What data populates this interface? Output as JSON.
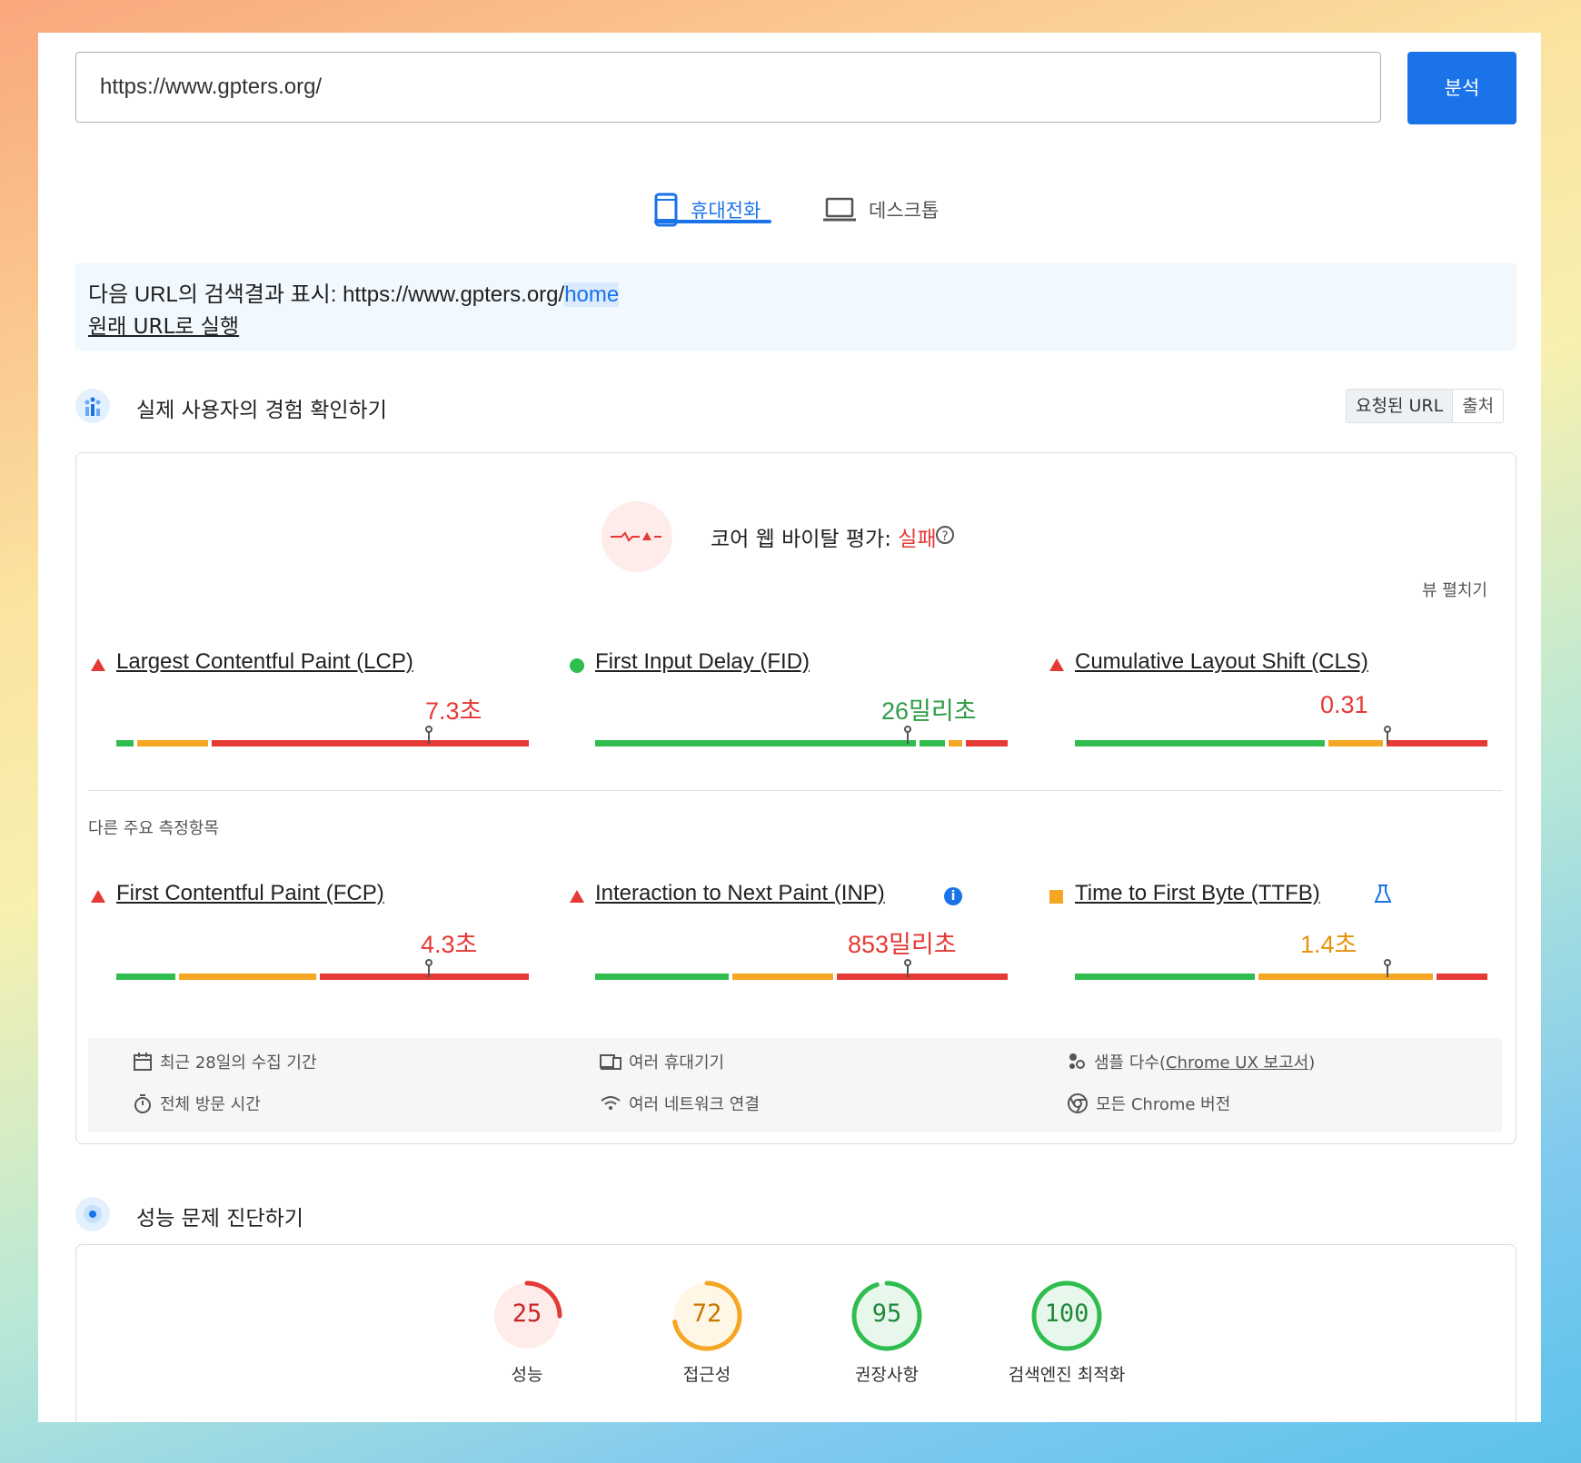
{
  "search": {
    "url": "https://www.gpters.org/",
    "analyze_label": "분석"
  },
  "tabs": [
    {
      "label": "휴대전화"
    },
    {
      "label": "데스크톱"
    }
  ],
  "redirect": {
    "prefix": "다음 URL의 검색결과 표시: https://www.gpters.org/",
    "highlight": "home",
    "link": "원래 URL로 실행"
  },
  "field": {
    "title": "실제 사용자의 경험 확인하기",
    "toggle": [
      "요청된 URL",
      "출처"
    ],
    "assessment_label": "코어 웹 바이탈 평가: ",
    "assessment_status": "실패",
    "expand_label": "뷰 펼치기",
    "core_metrics": [
      {
        "name": "Largest Contentful Paint (LCP)",
        "value": "7.3초",
        "status": "poor",
        "marker": 0.75
      },
      {
        "name": "First Input Delay (FID)",
        "value": "26밀리초",
        "status": "good",
        "marker": 0.75
      },
      {
        "name": "Cumulative Layout Shift (CLS)",
        "value": "0.31",
        "status": "poor",
        "marker": 0.75
      }
    ],
    "other_label": "다른 주요 측정항목",
    "other_metrics": [
      {
        "name": "First Contentful Paint (FCP)",
        "value": "4.3초",
        "status": "poor",
        "marker": 0.75
      },
      {
        "name": "Interaction to Next Paint (INP)",
        "value": "853밀리초",
        "status": "poor",
        "marker": 0.75
      },
      {
        "name": "Time to First Byte (TTFB)",
        "value": "1.4초",
        "status": "average",
        "marker": 0.75
      }
    ],
    "footer": {
      "period": "최근 28일의 수집 기간",
      "devices": "여러 휴대기기",
      "samples_prefix": "샘플 다수(",
      "samples_link": "Chrome UX 보고서",
      "samples_suffix": ")",
      "duration": "전체 방문 시간",
      "network": "여러 네트워크 연결",
      "chrome": "모든 Chrome 버전"
    }
  },
  "diagnose": {
    "title": "성능 문제 진단하기",
    "scores": [
      {
        "value": "25",
        "label": "성능",
        "ratio": 0.25,
        "color": "#e53935",
        "bg": "#fdecea"
      },
      {
        "value": "72",
        "label": "접근성",
        "ratio": 0.72,
        "color": "#f5a623",
        "bg": "#fff6e6"
      },
      {
        "value": "95",
        "label": "권장사항",
        "ratio": 0.95,
        "color": "#2ebd4e",
        "bg": "#e8f7ec"
      },
      {
        "value": "100",
        "label": "검색엔진 최적화",
        "ratio": 1.0,
        "color": "#2ebd4e",
        "bg": "#e8f7ec"
      }
    ]
  },
  "colors": {
    "accent": "#1a73e8",
    "poor": "#e53935",
    "average": "#f5a623",
    "good": "#2ebd4e"
  }
}
